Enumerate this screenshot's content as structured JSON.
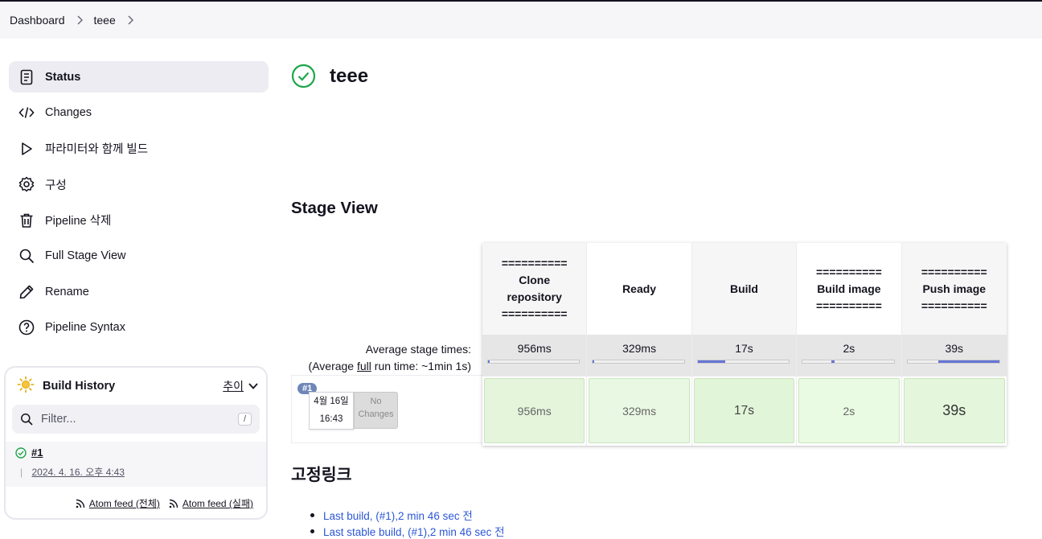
{
  "breadcrumb": [
    "Dashboard",
    "teee"
  ],
  "sidebar": {
    "items": [
      {
        "label": "Status",
        "icon": "status-icon"
      },
      {
        "label": "Changes",
        "icon": "code-icon"
      },
      {
        "label": "파라미터와 함께 빌드",
        "icon": "play-icon"
      },
      {
        "label": "구성",
        "icon": "gear-icon"
      },
      {
        "label": "Pipeline 삭제",
        "icon": "trash-icon"
      },
      {
        "label": "Full Stage View",
        "icon": "search-icon"
      },
      {
        "label": "Rename",
        "icon": "pencil-icon"
      },
      {
        "label": "Pipeline Syntax",
        "icon": "help-icon"
      }
    ]
  },
  "build_history": {
    "title": "Build History",
    "trend_label": "추이",
    "filter_placeholder": "Filter...",
    "filter_shortcut": "/",
    "builds": [
      {
        "number": "#1",
        "date": "2024. 4. 16. 오후 4:43"
      }
    ],
    "feeds": [
      "Atom feed (전체)",
      "Atom feed (실패)"
    ]
  },
  "project": {
    "title": "teee",
    "status_color": "#1ea64b"
  },
  "stage_view": {
    "title": "Stage View",
    "avg_label_1": "Average stage times:",
    "avg_label_2_pre": "(Average ",
    "avg_label_2_u": "full",
    "avg_label_2_post": " run time: ~1min 1s)",
    "run": {
      "badge": "#1",
      "date": "4월 16일",
      "time": "16:43",
      "changes_1": "No",
      "changes_2": "Changes"
    },
    "stages": [
      {
        "name_lines": [
          "==========",
          "Clone",
          "repository",
          "=========="
        ],
        "avg": "956ms",
        "time": "956ms",
        "fraction": 0.02,
        "cell_color": "#e4f5dc"
      },
      {
        "name_lines": [
          "Ready"
        ],
        "avg": "329ms",
        "time": "329ms",
        "fraction": 0.01,
        "cell_color": "#e9f8e2"
      },
      {
        "name_lines": [
          "Build"
        ],
        "avg": "17s",
        "time": "17s",
        "fraction": 0.3,
        "cell_color": "#e1f5d8"
      },
      {
        "name_lines": [
          "==========",
          "Build image",
          "=========="
        ],
        "avg": "2s",
        "time": "2s",
        "fraction": 0.03,
        "cell_color": "#eafbe3"
      },
      {
        "name_lines": [
          "==========",
          "Push image",
          "=========="
        ],
        "avg": "39s",
        "time": "39s",
        "fraction": 0.66,
        "cell_color": "#e4f7dc"
      }
    ]
  },
  "permalinks": {
    "title": "고정링크",
    "items": [
      "Last build, (#1),2 min 46 sec 전",
      "Last stable build, (#1),2 min 46 sec 전"
    ]
  }
}
